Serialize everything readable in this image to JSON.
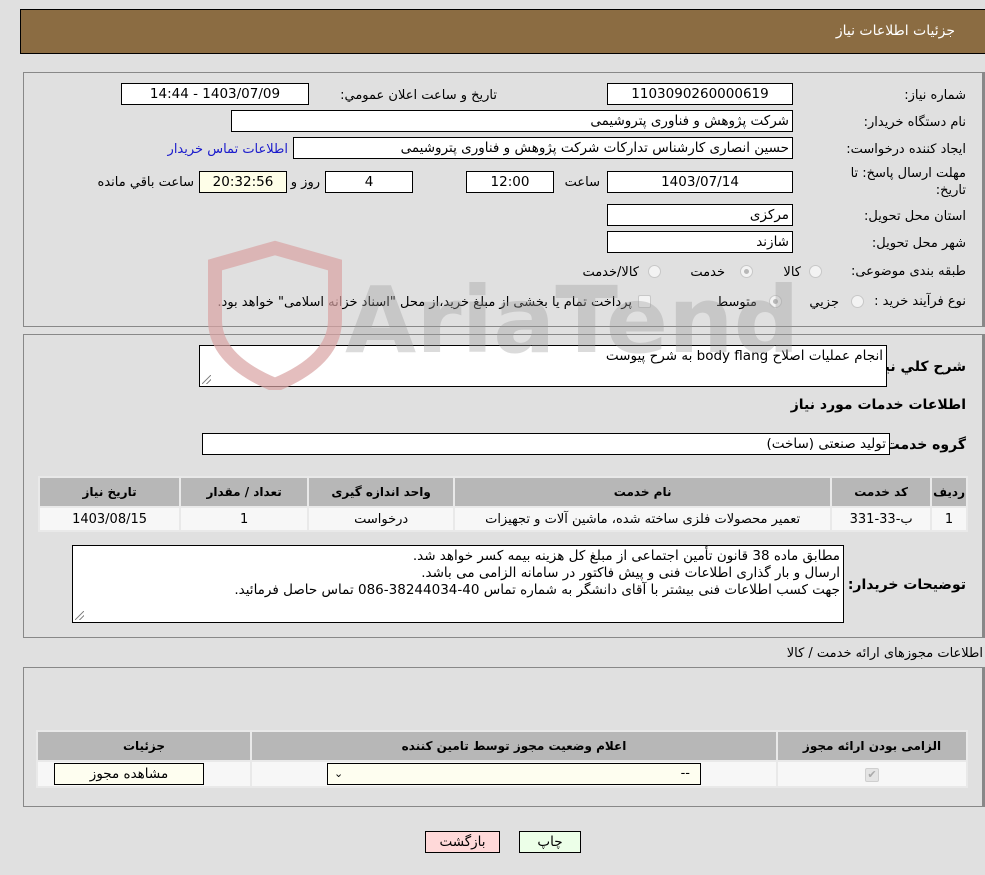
{
  "header": {
    "title": "جزئیات اطلاعات نیاز"
  },
  "details": {
    "need_number_label": "شماره نیاز:",
    "need_number": "1103090260000619",
    "announce_label": "تاریخ و ساعت اعلان عمومي:",
    "announce_value": "1403/07/09 - 14:44",
    "buyer_org_label": "نام دستگاه خريدار:",
    "buyer_org": "شرکت پژوهش و فناوری پتروشیمی",
    "requester_label": "ايجاد کننده درخواست:",
    "requester": "حسین انصاری کارشناس تدارکات شرکت پژوهش و فناوری پتروشیمی",
    "buyer_contact_link": "اطلاعات تماس خريدار",
    "deadline_label_1": "مهلت ارسال پاسخ: تا",
    "deadline_label_2": "تاریخ:",
    "deadline_date": "1403/07/14",
    "time_label": "ساعت",
    "deadline_time": "12:00",
    "days_value": "4",
    "days_label": "روز و",
    "remaining_time": "20:32:56",
    "remaining_label": "ساعت باقي مانده",
    "province_label": "استان محل تحويل:",
    "province": "مرکزی",
    "city_label": "شهر محل تحويل:",
    "city": "شازند",
    "category_label": "طبقه بندی موضوعی:",
    "category_options": [
      {
        "label": "کالا",
        "checked": false
      },
      {
        "label": "خدمت",
        "checked": true
      },
      {
        "label": "کالا/خدمت",
        "checked": false
      }
    ],
    "process_label": "نوع فرآيند خريد :",
    "process_options": [
      {
        "label": "جزيي",
        "checked": false
      },
      {
        "label": "متوسط",
        "checked": true
      }
    ],
    "payment_note": "پرداخت تمام يا بخشی از مبلغ خريد،از محل \"اسناد خزانه اسلامی\" خواهد بود.",
    "payment_checked": false
  },
  "description": {
    "summary_label": "شرح كلي نياز:",
    "summary": "انجام عملیات اصلاح body flang به شرح پیوست",
    "services_heading": "اطلاعات خدمات مورد نياز",
    "service_group_label": "گروه خدمت:",
    "service_group": "تولید صنعتی (ساخت)"
  },
  "services_table": {
    "headers": [
      "رديف",
      "کد خدمت",
      "نام خدمت",
      "واحد اندازه گيری",
      "تعداد / مقدار",
      "تاريخ نياز"
    ],
    "rows": [
      [
        "1",
        "ب-33-331",
        "تعمیر محصولات فلزی ساخته شده، ماشین آلات و تجهیزات",
        "درخواست",
        "1",
        "1403/08/15"
      ]
    ]
  },
  "buyer_notes": {
    "label": "توضيحات خريدار:",
    "lines": [
      "مطابق ماده 38 قانون تأمین اجتماعی از مبلغ کل هزینه بیمه کسر خواهد شد.",
      "ارسال و بار گذاری اطلاعات فنی و پیش فاکتور در سامانه الزامی می باشد.",
      "جهت کسب اطلاعات فنی بیشتر با آقای دانشگر به شماره تماس  40-38244034-086 تماس حاصل فرمائید."
    ]
  },
  "permits": {
    "heading": "اطلاعات مجوزهای ارائه خدمت / کالا",
    "headers": [
      "الزامی بودن ارائه مجوز",
      "اعلام وضعيت مجوز توسط تامين کننده",
      "جزئيات"
    ],
    "required_checked": true,
    "status_value": "--",
    "view_button": "مشاهده مجوز"
  },
  "footer": {
    "print_button": "چاپ",
    "back_button": "بازگشت"
  },
  "watermark": {
    "text": "AriaTender.neT"
  },
  "colors": {
    "header_bg": "#8b6c42",
    "link": "#1a1acc",
    "back_bg": "#ffd9d9",
    "print_bg": "#ecffe8"
  }
}
